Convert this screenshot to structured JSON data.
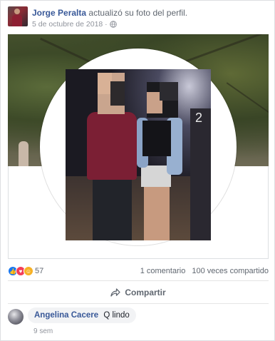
{
  "post": {
    "author": "Jorge Peralta",
    "action": "actualizó su foto del perfil.",
    "date": "5 de octubre de 2018 ·",
    "privacy_icon": "globe-icon"
  },
  "photo": {
    "jersey_number": "2"
  },
  "reactions": {
    "types": [
      "like-icon",
      "love-icon",
      "haha-icon"
    ],
    "count": "57",
    "comments": "1 comentario",
    "shares": "100 veces compartido"
  },
  "actions": {
    "share_label": "Compartir",
    "share_icon": "share-arrow-icon"
  },
  "comment": {
    "author": "Angelina Cacere",
    "text": "Q lindo",
    "time": "9 sem"
  },
  "colors": {
    "link": "#385898",
    "secondary": "#606770",
    "like": "#1877f2",
    "love": "#f33e58",
    "haha": "#f7b125"
  }
}
